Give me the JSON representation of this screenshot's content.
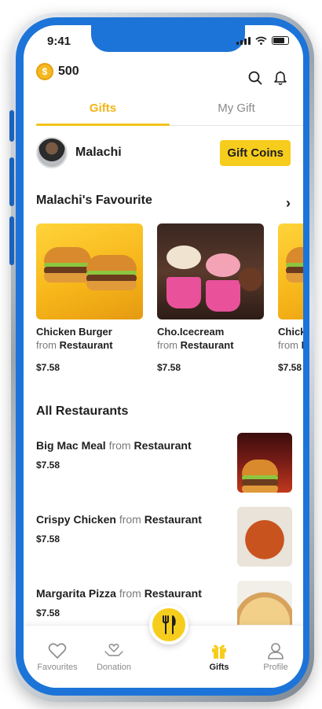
{
  "status": {
    "time": "9:41"
  },
  "wallet": {
    "coin_glyph": "$",
    "balance": "500"
  },
  "tabs": [
    {
      "label": "Gifts",
      "active": true
    },
    {
      "label": "My Gift",
      "active": false
    }
  ],
  "profile": {
    "name": "Malachi",
    "gift_button": "Gift Coins"
  },
  "favourites": {
    "title": "Malachi's Favourite",
    "items": [
      {
        "name": "Chicken Burger",
        "from": "from",
        "restaurant": "Restaurant",
        "price": "$7.58"
      },
      {
        "name": "Cho.Icecream",
        "from": "from",
        "restaurant": "Restaurant",
        "price": "$7.58"
      },
      {
        "name": "Chicke",
        "from": "from",
        "restaurant": "R",
        "price": "$7.58"
      }
    ]
  },
  "restaurants": {
    "title": "All Restaurants",
    "items": [
      {
        "name": "Big Mac Meal",
        "from": "from",
        "restaurant": "Restaurant",
        "price": "$7.58"
      },
      {
        "name": "Crispy Chicken",
        "from": "from",
        "restaurant": "Restaurant",
        "price": "$7.58"
      },
      {
        "name": "Margarita Pizza",
        "from": "from",
        "restaurant": "Restaurant",
        "price": "$7.58"
      }
    ]
  },
  "nav": {
    "favourites": "Favourites",
    "donation": "Donation",
    "gifts": "Gifts",
    "profile": "Profile"
  },
  "colors": {
    "accent": "#f7cd1d",
    "frame": "#1d74d8",
    "active_tab": "#f2b516"
  }
}
